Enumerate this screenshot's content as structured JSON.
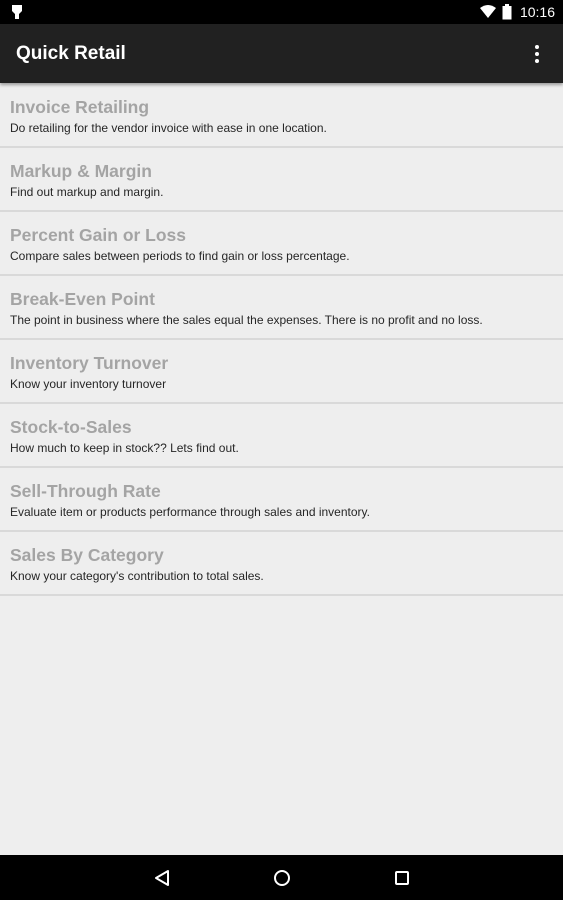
{
  "status_bar": {
    "time": "10:16",
    "icons": [
      "notification-icon",
      "wifi-icon",
      "battery-icon"
    ]
  },
  "app_bar": {
    "title": "Quick Retail",
    "overflow_icon": "more-vert-icon"
  },
  "menu": {
    "items": [
      {
        "title": "Invoice Retailing",
        "description": "Do retailing for the vendor invoice with ease in one location."
      },
      {
        "title": "Markup & Margin",
        "description": "Find out markup and margin."
      },
      {
        "title": "Percent Gain or Loss",
        "description": "Compare sales between periods to find gain or loss percentage."
      },
      {
        "title": "Break-Even Point",
        "description": "The point in business where the sales equal the expenses. There is no profit and no loss."
      },
      {
        "title": "Inventory Turnover",
        "description": "Know your inventory turnover"
      },
      {
        "title": "Stock-to-Sales",
        "description": "How much to keep in stock?? Lets find out."
      },
      {
        "title": "Sell-Through Rate",
        "description": "Evaluate item or products performance through sales and inventory."
      },
      {
        "title": "Sales By Category",
        "description": "Know your category's contribution to total sales."
      }
    ]
  },
  "nav_bar": {
    "icons": [
      "back-icon",
      "home-icon",
      "recents-icon"
    ]
  },
  "colors": {
    "app_bar": "#212121",
    "background": "#eeeeee",
    "item_title": "#a4a4a4",
    "item_description": "#262626",
    "divider": "#d9d9d9"
  }
}
